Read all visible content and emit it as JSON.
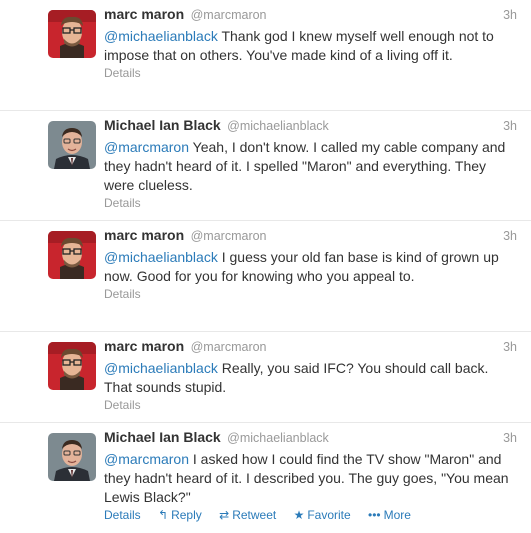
{
  "tweets": [
    {
      "fullname": "marc maron",
      "username": "@marcmaron",
      "time": "3h",
      "mention": "@michaelianblack",
      "body": " Thank god I knew myself well enough not to impose that on others. You've made kind of a living off it.",
      "details": "Details",
      "avatar": "avatar-marc"
    },
    {
      "fullname": "Michael Ian Black",
      "username": "@michaelianblack",
      "time": "3h",
      "mention": "@marcmaron",
      "body": " Yeah, I don't know. I called my cable company and they hadn't heard of it. I spelled \"Maron\" and everything. They were clueless.",
      "details": "Details",
      "avatar": "avatar-michael"
    },
    {
      "fullname": "marc maron",
      "username": "@marcmaron",
      "time": "3h",
      "mention": "@michaelianblack",
      "body": " I guess your old fan base is kind of grown up now. Good for you for knowing who you appeal to.",
      "details": "Details",
      "avatar": "avatar-marc"
    },
    {
      "fullname": "marc maron",
      "username": "@marcmaron",
      "time": "3h",
      "mention": "@michaelianblack",
      "body": " Really, you said IFC? You should call back. That sounds stupid.",
      "details": "Details",
      "avatar": "avatar-marc"
    },
    {
      "fullname": "Michael Ian Black",
      "username": "@michaelianblack",
      "time": "3h",
      "mention": "@marcmaron",
      "body": " I asked how I could find the TV show \"Maron\" and they hadn't heard of it. I described you. The guy goes, \"You mean Lewis Black?\"",
      "details": "Details",
      "reply": "Reply",
      "retweet": "Retweet",
      "favorite": "Favorite",
      "more": "More",
      "avatar": "avatar-michael"
    }
  ],
  "colors": {
    "link": "#2b7bb9",
    "meta": "#999999",
    "text": "#333333",
    "divider": "#e8e8e8"
  },
  "icons": {
    "reply": "reply-icon",
    "retweet": "retweet-icon",
    "favorite": "star-icon",
    "more": "more-dots-icon"
  }
}
